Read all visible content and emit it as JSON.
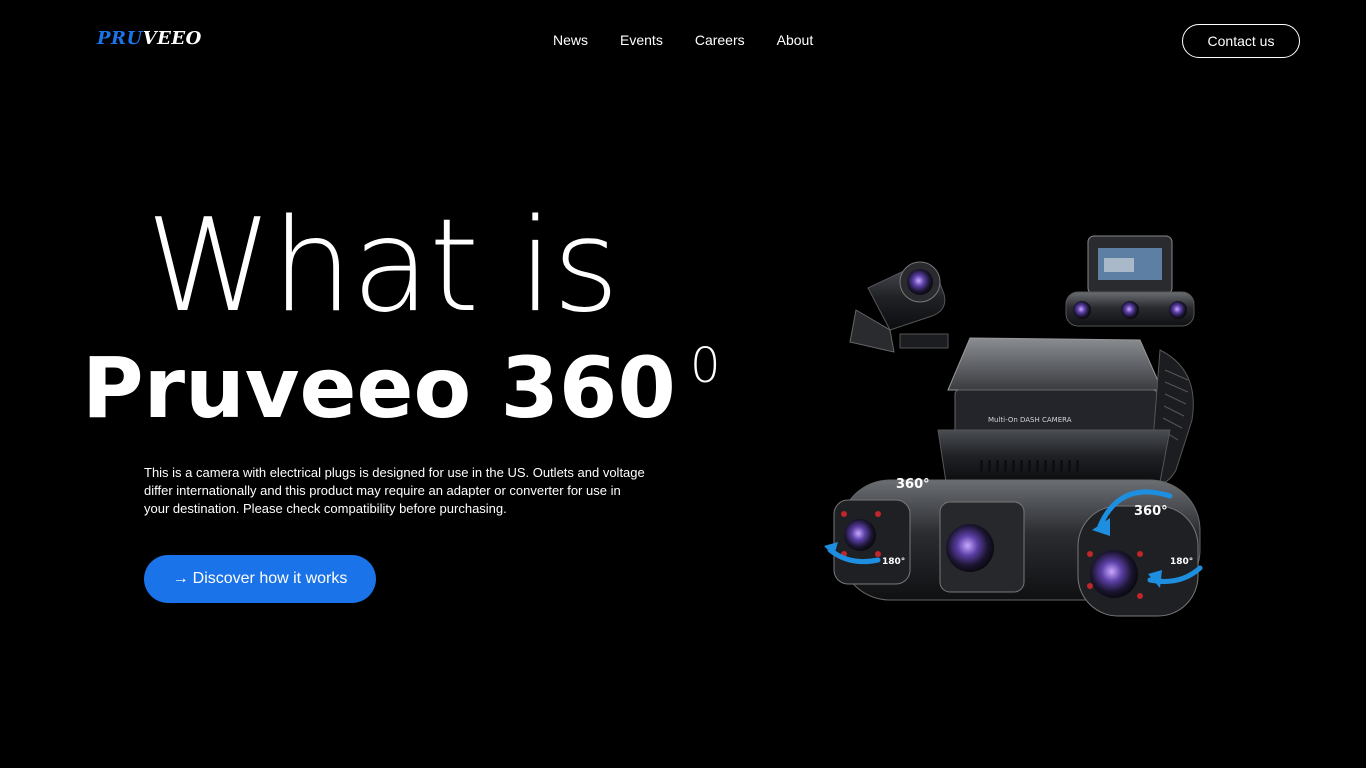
{
  "header": {
    "logo": {
      "part1": "PRU",
      "part2": "VEEO"
    },
    "nav": [
      {
        "label": "News"
      },
      {
        "label": "Events"
      },
      {
        "label": "Careers"
      },
      {
        "label": "About"
      }
    ],
    "contact_label": "Contact us"
  },
  "hero": {
    "line1": "What is",
    "line2": "Pruveeo 360",
    "superscript": "0",
    "description": "This is a camera with electrical plugs is designed for use in the US. Outlets and voltage differ internationally and this product may require an adapter or converter for use in your destination. Please check compatibility before purchasing.",
    "cta_arrow": "→",
    "cta_label": "Discover how it works"
  },
  "product_image": {
    "labels": {
      "rotation_left": "360°",
      "rotation_right": "360°",
      "angle_left": "180°",
      "angle_right": "180°",
      "body_text": "DASH CAMERA",
      "brand_text": "Multi-On"
    }
  },
  "colors": {
    "background": "#000000",
    "accent": "#1a73e8",
    "text": "#ffffff"
  }
}
